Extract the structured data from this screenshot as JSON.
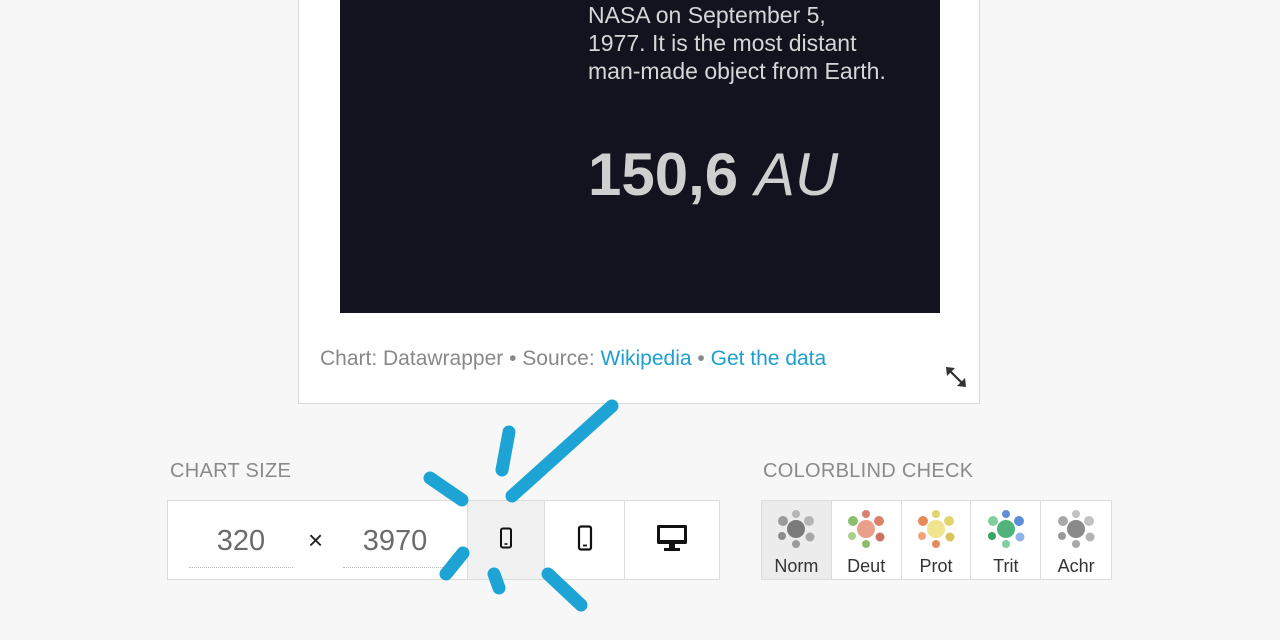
{
  "preview": {
    "description": "NASA on September 5, 1977. It is the most distant man-made object from Earth.",
    "value_number": "150,6",
    "value_unit": "AU",
    "footer": {
      "chart_credit": "Chart: Datawrapper",
      "separator": "•",
      "source_label": "Source:",
      "source_link": "Wikipedia",
      "data_link": "Get the data"
    },
    "resize_icon": "resize-diagonal-icon"
  },
  "chart_size": {
    "label": "CHART SIZE",
    "width": "320",
    "height": "3970",
    "times": "×",
    "devices": [
      {
        "name": "mobile-small",
        "icon": "phone-small-icon",
        "active": true
      },
      {
        "name": "mobile",
        "icon": "phone-icon",
        "active": false
      },
      {
        "name": "desktop",
        "icon": "monitor-icon",
        "active": false
      }
    ]
  },
  "colorblind": {
    "label": "COLORBLIND CHECK",
    "modes": [
      {
        "label": "Norm",
        "active": true,
        "colors": [
          "#7a7a7a",
          "#9a9a9a",
          "#b5b5b5",
          "#8c8c8c",
          "#a6a6a6"
        ]
      },
      {
        "label": "Deut",
        "active": false,
        "colors": [
          "#d9826b",
          "#8cbf6b",
          "#e8a08a",
          "#c97460",
          "#a9cf8d"
        ]
      },
      {
        "label": "Prot",
        "active": false,
        "colors": [
          "#e3d36b",
          "#e78a5a",
          "#f0e48f",
          "#d9c557",
          "#f2a27a"
        ]
      },
      {
        "label": "Trit",
        "active": false,
        "colors": [
          "#4fb37a",
          "#5b8fd6",
          "#7fd09e",
          "#3aa36a",
          "#8fb2e8"
        ]
      },
      {
        "label": "Achr",
        "active": false,
        "colors": [
          "#8a8a8a",
          "#a8a8a8",
          "#c2c2c2",
          "#999999",
          "#b3b3b3"
        ]
      }
    ]
  },
  "colors": {
    "accent": "#1d9fcf",
    "panel_bg": "#131320",
    "doodle": "#1da4d4"
  }
}
